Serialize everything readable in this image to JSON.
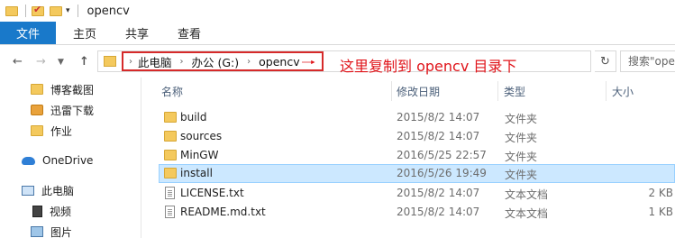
{
  "window": {
    "title": "opencv"
  },
  "ribbon": {
    "tabs": [
      "文件",
      "主页",
      "共享",
      "查看"
    ]
  },
  "address": {
    "crumbs": [
      "此电脑",
      "办公 (G:)",
      "opencv"
    ],
    "annotation": "这里复制到 opencv 目录下",
    "search_placeholder": "搜索\"opencv\""
  },
  "sidebar": {
    "items": [
      {
        "label": "博客截图",
        "icon": "folder-icon"
      },
      {
        "label": "迅雷下载",
        "icon": "xunlei-icon"
      },
      {
        "label": "作业",
        "icon": "folder-icon"
      },
      {
        "label": "OneDrive",
        "icon": "onedrive-icon"
      },
      {
        "label": "此电脑",
        "icon": "this-pc-icon"
      },
      {
        "label": "视频",
        "icon": "video-icon"
      },
      {
        "label": "图片",
        "icon": "pictures-icon"
      }
    ]
  },
  "columns": {
    "name": "名称",
    "modified": "修改日期",
    "type": "类型",
    "size": "大小"
  },
  "files": [
    {
      "name": "build",
      "modified": "2015/8/2 14:07",
      "type": "文件夹",
      "size": "",
      "icon": "folder-icon"
    },
    {
      "name": "sources",
      "modified": "2015/8/2 14:07",
      "type": "文件夹",
      "size": "",
      "icon": "folder-icon"
    },
    {
      "name": "MinGW",
      "modified": "2016/5/25 22:57",
      "type": "文件夹",
      "size": "",
      "icon": "folder-icon"
    },
    {
      "name": "install",
      "modified": "2016/5/26 19:49",
      "type": "文件夹",
      "size": "",
      "icon": "folder-icon",
      "selected": true
    },
    {
      "name": "LICENSE.txt",
      "modified": "2015/8/2 14:07",
      "type": "文本文档",
      "size": "2 KB",
      "icon": "text-file-icon"
    },
    {
      "name": "README.md.txt",
      "modified": "2015/8/2 14:07",
      "type": "文本文档",
      "size": "1 KB",
      "icon": "text-file-icon"
    }
  ],
  "colors": {
    "accent": "#1979ca",
    "annotation": "#e0141a",
    "selection": "#cce8ff",
    "folder": "#f4c95d"
  }
}
